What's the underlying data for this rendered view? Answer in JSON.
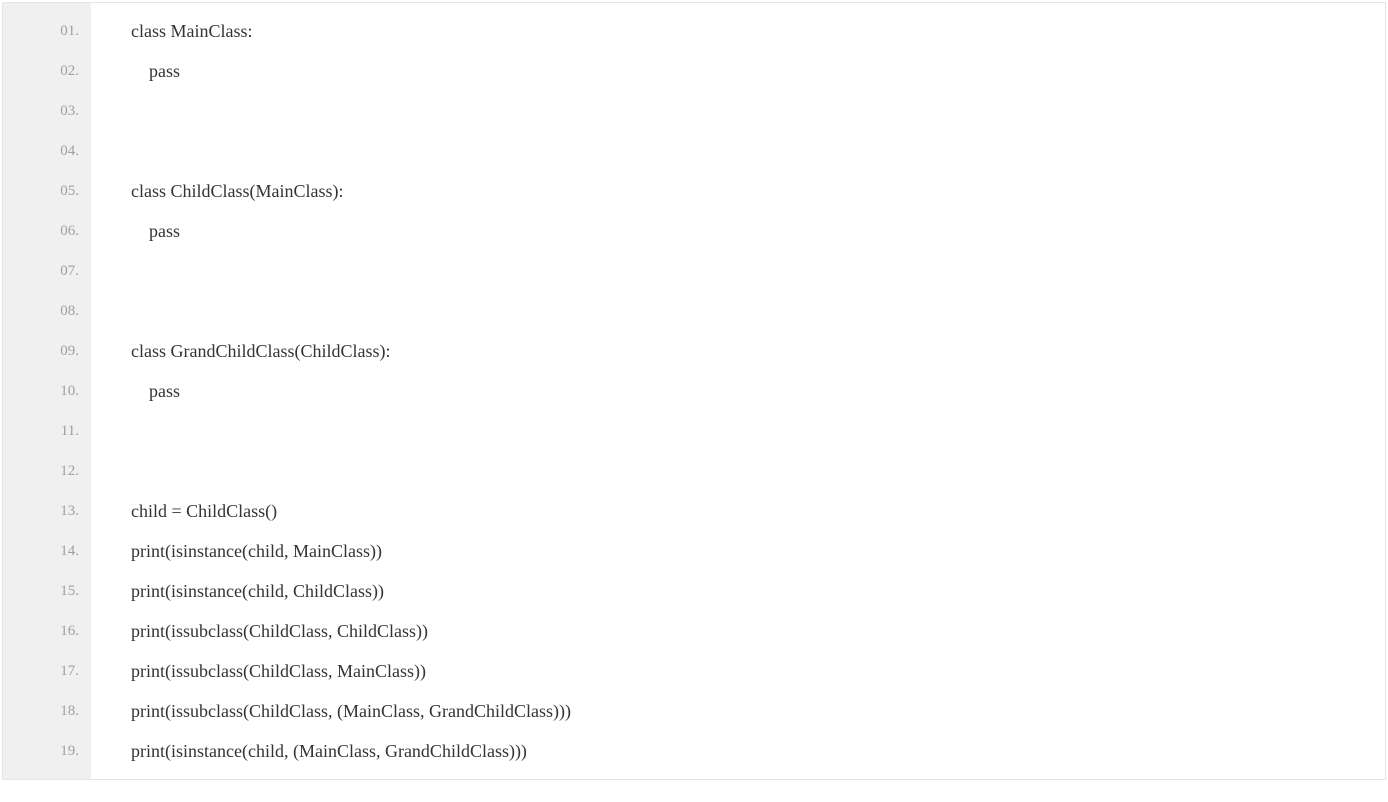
{
  "code": {
    "lines": [
      {
        "num": "01.",
        "text": "class MainClass:"
      },
      {
        "num": "02.",
        "text": "    pass"
      },
      {
        "num": "03.",
        "text": ""
      },
      {
        "num": "04.",
        "text": ""
      },
      {
        "num": "05.",
        "text": "class ChildClass(MainClass):"
      },
      {
        "num": "06.",
        "text": "    pass"
      },
      {
        "num": "07.",
        "text": ""
      },
      {
        "num": "08.",
        "text": ""
      },
      {
        "num": "09.",
        "text": "class GrandChildClass(ChildClass):"
      },
      {
        "num": "10.",
        "text": "    pass"
      },
      {
        "num": "11.",
        "text": ""
      },
      {
        "num": "12.",
        "text": ""
      },
      {
        "num": "13.",
        "text": "child = ChildClass()"
      },
      {
        "num": "14.",
        "text": "print(isinstance(child, MainClass))"
      },
      {
        "num": "15.",
        "text": "print(isinstance(child, ChildClass))"
      },
      {
        "num": "16.",
        "text": "print(issubclass(ChildClass, ChildClass))"
      },
      {
        "num": "17.",
        "text": "print(issubclass(ChildClass, MainClass))"
      },
      {
        "num": "18.",
        "text": "print(issubclass(ChildClass, (MainClass, GrandChildClass)))"
      },
      {
        "num": "19.",
        "text": "print(isinstance(child, (MainClass, GrandChildClass)))"
      }
    ]
  }
}
